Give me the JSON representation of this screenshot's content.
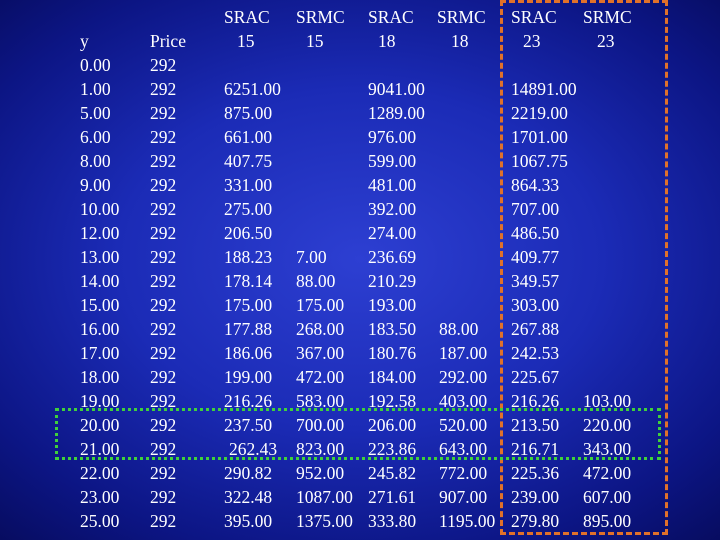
{
  "headers": {
    "srac15": [
      "SRAC",
      "15"
    ],
    "srmc15": [
      "SRMC",
      "15"
    ],
    "srac18": [
      "SRAC",
      "18"
    ],
    "srmc18": [
      "SRMC",
      "18"
    ],
    "srac23": [
      "SRAC",
      "23"
    ],
    "srmc23": [
      "SRMC",
      "23"
    ],
    "y": "y",
    "price": "Price"
  },
  "highlight_colors": {
    "column_box": "#e0712a",
    "row_box": "#3fd13a"
  },
  "rows": [
    {
      "y": "0.00",
      "price": "292",
      "srac15": "",
      "srmc15": "",
      "srac18": "",
      "srmc18": "",
      "srac23": "",
      "srmc23": ""
    },
    {
      "y": "1.00",
      "price": "292",
      "srac15": "6251.00",
      "srmc15": "",
      "srac18": "9041.00",
      "srmc18": "",
      "srac23": "14891.00",
      "srmc23": ""
    },
    {
      "y": "5.00",
      "price": "292",
      "srac15": "875.00",
      "srmc15": "",
      "srac18": "1289.00",
      "srmc18": "",
      "srac23": "2219.00",
      "srmc23": ""
    },
    {
      "y": "6.00",
      "price": "292",
      "srac15": "661.00",
      "srmc15": "",
      "srac18": "976.00",
      "srmc18": "",
      "srac23": "1701.00",
      "srmc23": ""
    },
    {
      "y": "8.00",
      "price": "292",
      "srac15": "407.75",
      "srmc15": "",
      "srac18": "599.00",
      "srmc18": "",
      "srac23": "1067.75",
      "srmc23": ""
    },
    {
      "y": "9.00",
      "price": "292",
      "srac15": "331.00",
      "srmc15": "",
      "srac18": "481.00",
      "srmc18": "",
      "srac23": "864.33",
      "srmc23": ""
    },
    {
      "y": "10.00",
      "price": "292",
      "srac15": "275.00",
      "srmc15": "",
      "srac18": "392.00",
      "srmc18": "",
      "srac23": "707.00",
      "srmc23": ""
    },
    {
      "y": "12.00",
      "price": "292",
      "srac15": "206.50",
      "srmc15": "",
      "srac18": "274.00",
      "srmc18": "",
      "srac23": "486.50",
      "srmc23": ""
    },
    {
      "y": "13.00",
      "price": "292",
      "srac15": "188.23",
      "srmc15": "7.00",
      "srac18": "236.69",
      "srmc18": "",
      "srac23": "409.77",
      "srmc23": ""
    },
    {
      "y": "14.00",
      "price": "292",
      "srac15": "178.14",
      "srmc15": "88.00",
      "srac18": "210.29",
      "srmc18": "",
      "srac23": "349.57",
      "srmc23": ""
    },
    {
      "y": "15.00",
      "price": "292",
      "srac15": "175.00",
      "srmc15": "175.00",
      "srac18": "193.00",
      "srmc18": "",
      "srac23": "303.00",
      "srmc23": ""
    },
    {
      "y": "16.00",
      "price": "292",
      "srac15": "177.88",
      "srmc15": "268.00",
      "srac18": "183.50",
      "srmc18": "88.00",
      "srac23": "267.88",
      "srmc23": ""
    },
    {
      "y": "17.00",
      "price": "292",
      "srac15": "186.06",
      "srmc15": "367.00",
      "srac18": "180.76",
      "srmc18": "187.00",
      "srac23": "242.53",
      "srmc23": ""
    },
    {
      "y": "18.00",
      "price": "292",
      "srac15": "199.00",
      "srmc15": "472.00",
      "srac18": "184.00",
      "srmc18": "292.00",
      "srac23": "225.67",
      "srmc23": ""
    },
    {
      "y": "19.00",
      "price": "292",
      "srac15": "216.26",
      "srmc15": "583.00",
      "srac18": "192.58",
      "srmc18": "403.00",
      "srac23": "216.26",
      "srmc23": "103.00"
    },
    {
      "y": "20.00",
      "price": "292",
      "srac15": "237.50",
      "srmc15": "700.00",
      "srac18": "206.00",
      "srmc18": "520.00",
      "srac23": "213.50",
      "srmc23": "220.00"
    },
    {
      "y": "21.00",
      "price": "292",
      "srac15": "262.43",
      "srmc15": "823.00",
      "srac18": "223.86",
      "srmc18": "643.00",
      "srac23": "216.71",
      "srmc23": "343.00"
    },
    {
      "y": "22.00",
      "price": "292",
      "srac15": "290.82",
      "srmc15": "952.00",
      "srac18": "245.82",
      "srmc18": "772.00",
      "srac23": "225.36",
      "srmc23": "472.00"
    },
    {
      "y": "23.00",
      "price": "292",
      "srac15": "322.48",
      "srmc15": "1087.00",
      "srac18": "271.61",
      "srmc18": "907.00",
      "srac23": "239.00",
      "srmc23": "607.00"
    },
    {
      "y": "25.00",
      "price": "292",
      "srac15": "395.00",
      "srmc15": "1375.00",
      "srac18": "333.80",
      "srmc18": "1195.00",
      "srac23": "279.80",
      "srmc23": "895.00"
    }
  ]
}
